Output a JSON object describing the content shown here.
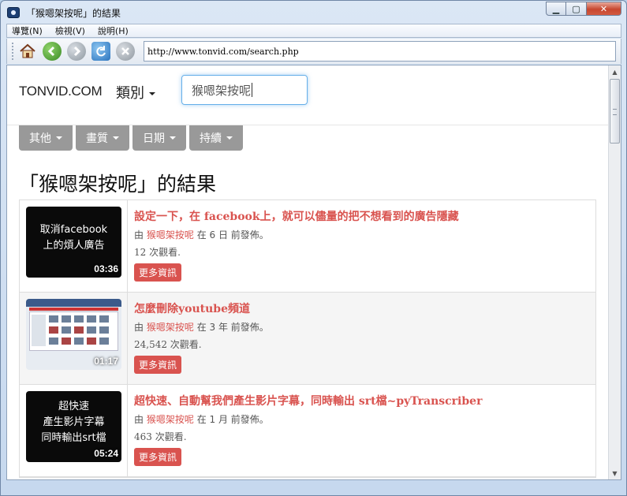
{
  "window": {
    "title": "「猴嗯架按呢」的結果"
  },
  "menubar": {
    "items": [
      "導覽(N)",
      "檢視(V)",
      "說明(H)"
    ]
  },
  "toolbar": {
    "address": "http://www.tonvid.com/search.php"
  },
  "site": {
    "brand": "TONVID.COM",
    "category_label": "類別",
    "search_value": "猴嗯架按呢"
  },
  "filters": [
    "其他",
    "畫質",
    "日期",
    "持續"
  ],
  "results_title": "「猴嗯架按呢」的結果",
  "results": [
    {
      "title": "設定一下，在 facebook上，就可以儘量的把不想看到的廣告隱藏",
      "by": "由",
      "author": "猴嗯架按呢",
      "posted": "在 6 日 前發佈。",
      "views": "12 次觀看.",
      "more": "更多資訊",
      "thumb_text": "取消facebook\n上的煩人廣告",
      "duration": "03:36"
    },
    {
      "title": "怎麼刪除youtube頻道",
      "by": "由",
      "author": "猴嗯架按呢",
      "posted": "在 3 年 前發佈。",
      "views": "24,542 次觀看.",
      "more": "更多資訊",
      "thumb_text": "",
      "duration": "01:17"
    },
    {
      "title": "超快速、自動幫我們產生影片字幕，同時輸出 srt檔~pyTranscriber",
      "by": "由",
      "author": "猴嗯架按呢",
      "posted": "在 1 月 前發佈。",
      "views": "463 次觀看.",
      "more": "更多資訊",
      "thumb_text": "超快速\n產生影片字幕\n同時輸出srt檔",
      "duration": "05:24"
    }
  ],
  "colors": {
    "accent": "#d9534f",
    "filter_bg": "#999999",
    "focus": "#66afe9"
  }
}
